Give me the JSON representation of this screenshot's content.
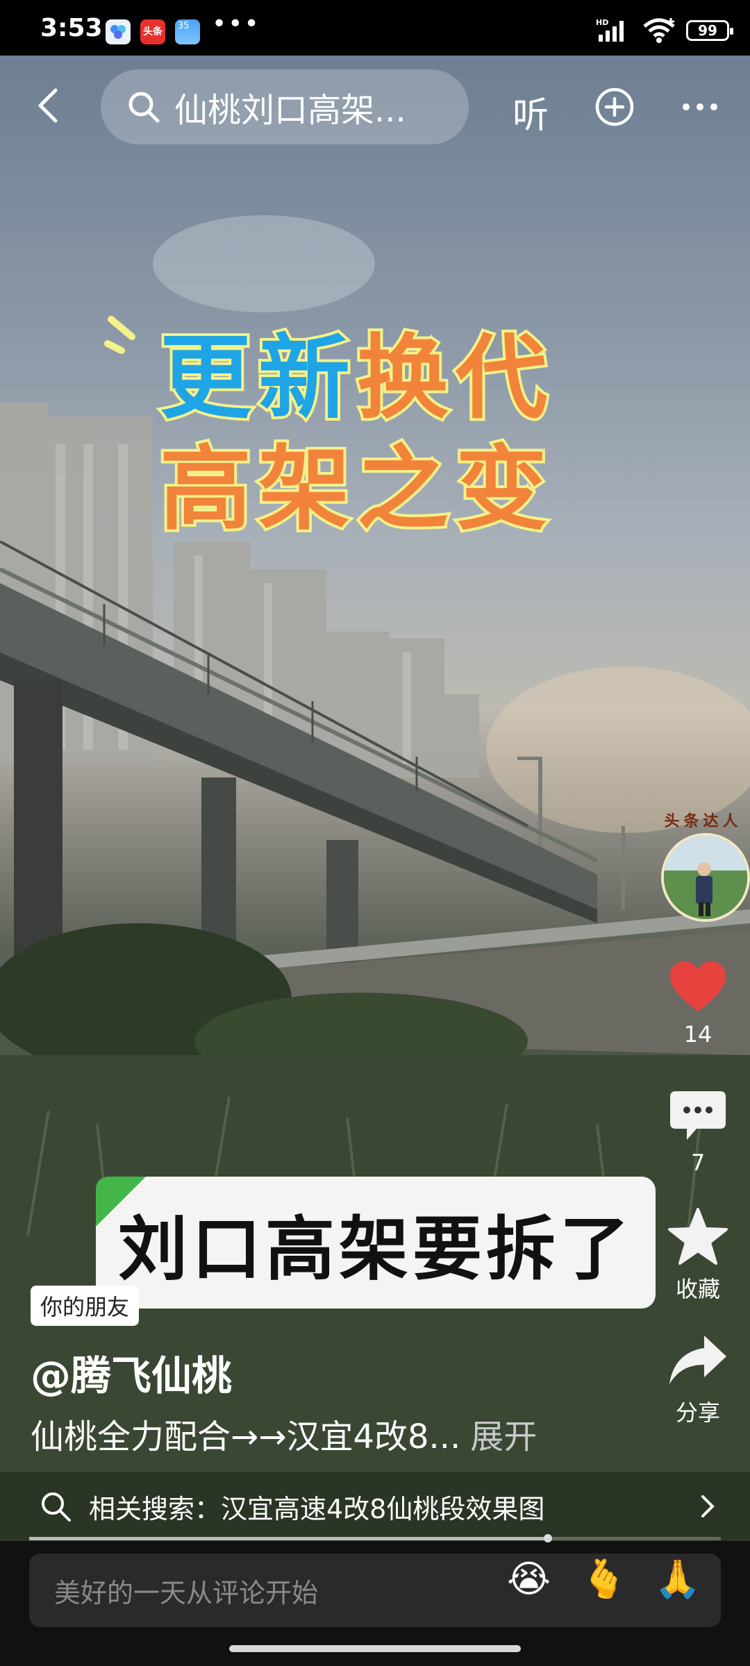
{
  "status_bar": {
    "time": "3:53",
    "apps": [
      "baidu-netdisk-icon",
      "toutiao-icon",
      "weather-icon"
    ],
    "toutiao_label": "头条",
    "weather_label": "35",
    "more": "•••",
    "network": "HD",
    "battery": "99"
  },
  "top_bar": {
    "search_text": "仙桃刘口高架...",
    "listen_label": "听"
  },
  "video": {
    "title_line1_part1": "更新",
    "title_line1_part2": "换代",
    "title_line2": "高架之变",
    "caption": "刘口高架要拆了"
  },
  "post": {
    "friend_tag": "你的朋友",
    "author": "@腾飞仙桃",
    "description": "仙桃全力配合→→汉宜4改8...",
    "expand_label": "展开"
  },
  "actions": {
    "avatar_badge": "头条达人",
    "likes": "14",
    "comments": "7",
    "favorite_label": "收藏",
    "share_label": "分享"
  },
  "related_search": {
    "text": "相关搜索：汉宜高速4改8仙桃段效果图"
  },
  "progress": {
    "fraction": 0.75
  },
  "comment_bar": {
    "placeholder": "美好的一天从评论开始",
    "emojis": [
      "😭",
      "🫰",
      "🙏"
    ]
  },
  "colors": {
    "like_red": "#e8423f",
    "title_blue": "#1fa4e6",
    "title_orange": "#f2833a",
    "title_outline": "#f3f28a"
  }
}
